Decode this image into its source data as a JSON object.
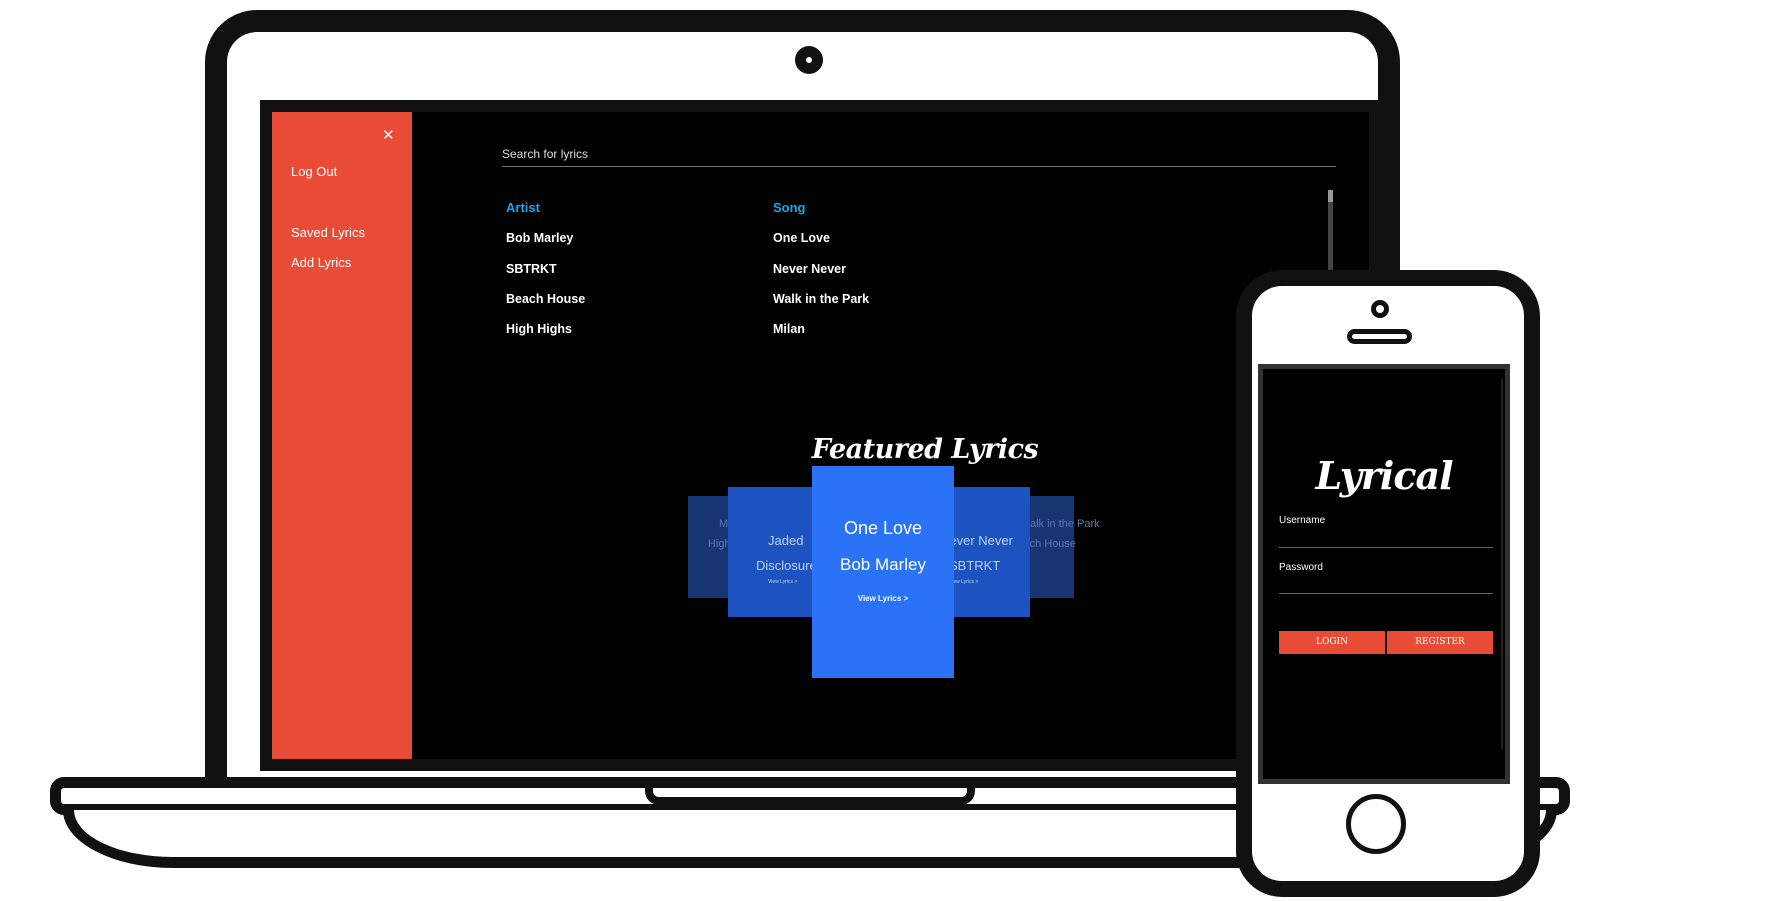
{
  "sidebar": {
    "close": "✕",
    "items": [
      "Log Out",
      "Saved Lyrics",
      "Add Lyrics"
    ]
  },
  "search": {
    "placeholder": "Search for lyrics"
  },
  "results": {
    "headers": [
      "Artist",
      "Song"
    ],
    "rows": [
      [
        "Bob Marley",
        "One Love"
      ],
      [
        "SBTRKT",
        "Never Never"
      ],
      [
        "Beach House",
        "Walk in the Park"
      ],
      [
        "High Highs",
        "Milan"
      ]
    ]
  },
  "featured": {
    "title": "Featured Lyrics",
    "main": {
      "song": "One Love",
      "artist": "Bob Marley",
      "link": "View Lyrics >"
    },
    "left1": {
      "song": "Jaded",
      "artist": "Disclosure",
      "link": "View Lyrics >"
    },
    "left2": {
      "song": "Milan",
      "artist": "High Highs"
    },
    "right1": {
      "song": "Never Never",
      "artist": "SBTRKT",
      "link": "View Lyrics >"
    },
    "right2": {
      "song": "Walk in the Park",
      "artist": "Beach House"
    }
  },
  "phone": {
    "logo": "Lyrical",
    "username_label": "Username",
    "password_label": "Password",
    "login": "LOGIN",
    "register": "REGISTER"
  },
  "colors": {
    "accent": "#e84b36",
    "card": "#2a72f6",
    "header": "#1aa3e8"
  }
}
